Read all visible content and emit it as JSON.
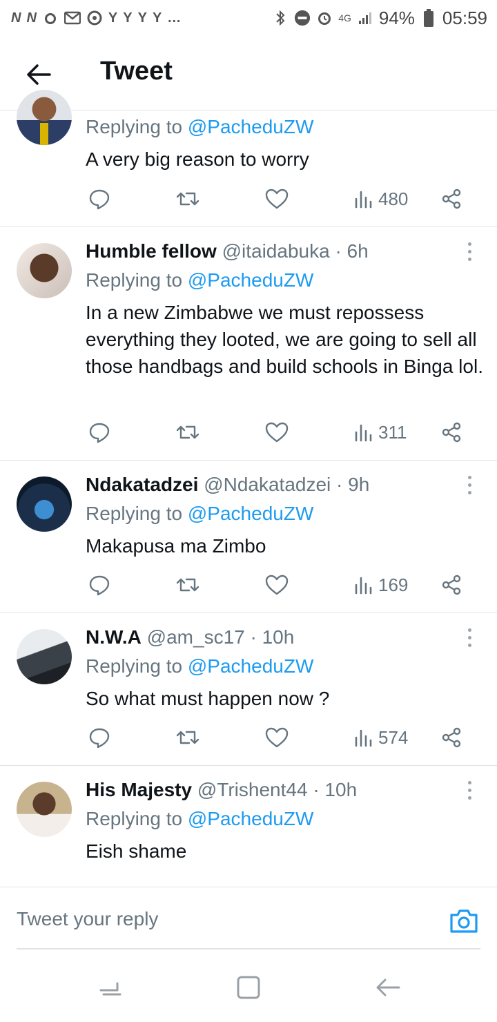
{
  "status_bar": {
    "left_icons": [
      "n-icon",
      "n-icon",
      "alarm-icon",
      "gmail-icon",
      "chrome-icon",
      "y-icon",
      "y-icon",
      "y-icon",
      "y-icon",
      "more-dots-icon"
    ],
    "network": "4G",
    "battery": "94%",
    "time": "05:59"
  },
  "header": {
    "title": "Tweet",
    "back_icon": "arrow-left-icon"
  },
  "tweets": [
    {
      "replying_prefix": "Replying to",
      "replying_to": "@PacheduZW",
      "text": "A very big reason to worry",
      "views": "480"
    },
    {
      "name": "Humble fellow",
      "handle": "@itaidabuka",
      "time": "· 6h",
      "replying_prefix": "Replying to",
      "replying_to": "@PacheduZW",
      "text": "In a new Zimbabwe we must repossess everything they looted, we are going to sell all those handbags and build schools in Binga lol.",
      "views": "311"
    },
    {
      "name": "Ndakatadzei",
      "handle": "@Ndakatadzei",
      "time": "· 9h",
      "replying_prefix": "Replying to",
      "replying_to": "@PacheduZW",
      "text": "Makapusa ma Zimbo",
      "views": "169"
    },
    {
      "name": "N.W.A",
      "handle": "@am_sc17",
      "time": "· 10h",
      "replying_prefix": "Replying to",
      "replying_to": "@PacheduZW",
      "text": "So what must happen now ?",
      "views": "574"
    },
    {
      "name": "His Majesty",
      "handle": "@Trishent44",
      "time": "· 10h",
      "replying_prefix": "Replying to",
      "replying_to": "@PacheduZW",
      "text": "Eish shame"
    }
  ],
  "composer": {
    "placeholder": "Tweet your reply"
  },
  "colors": {
    "link": "#1d9bf0",
    "muted": "#66757f",
    "divider": "#dfe3e6"
  }
}
